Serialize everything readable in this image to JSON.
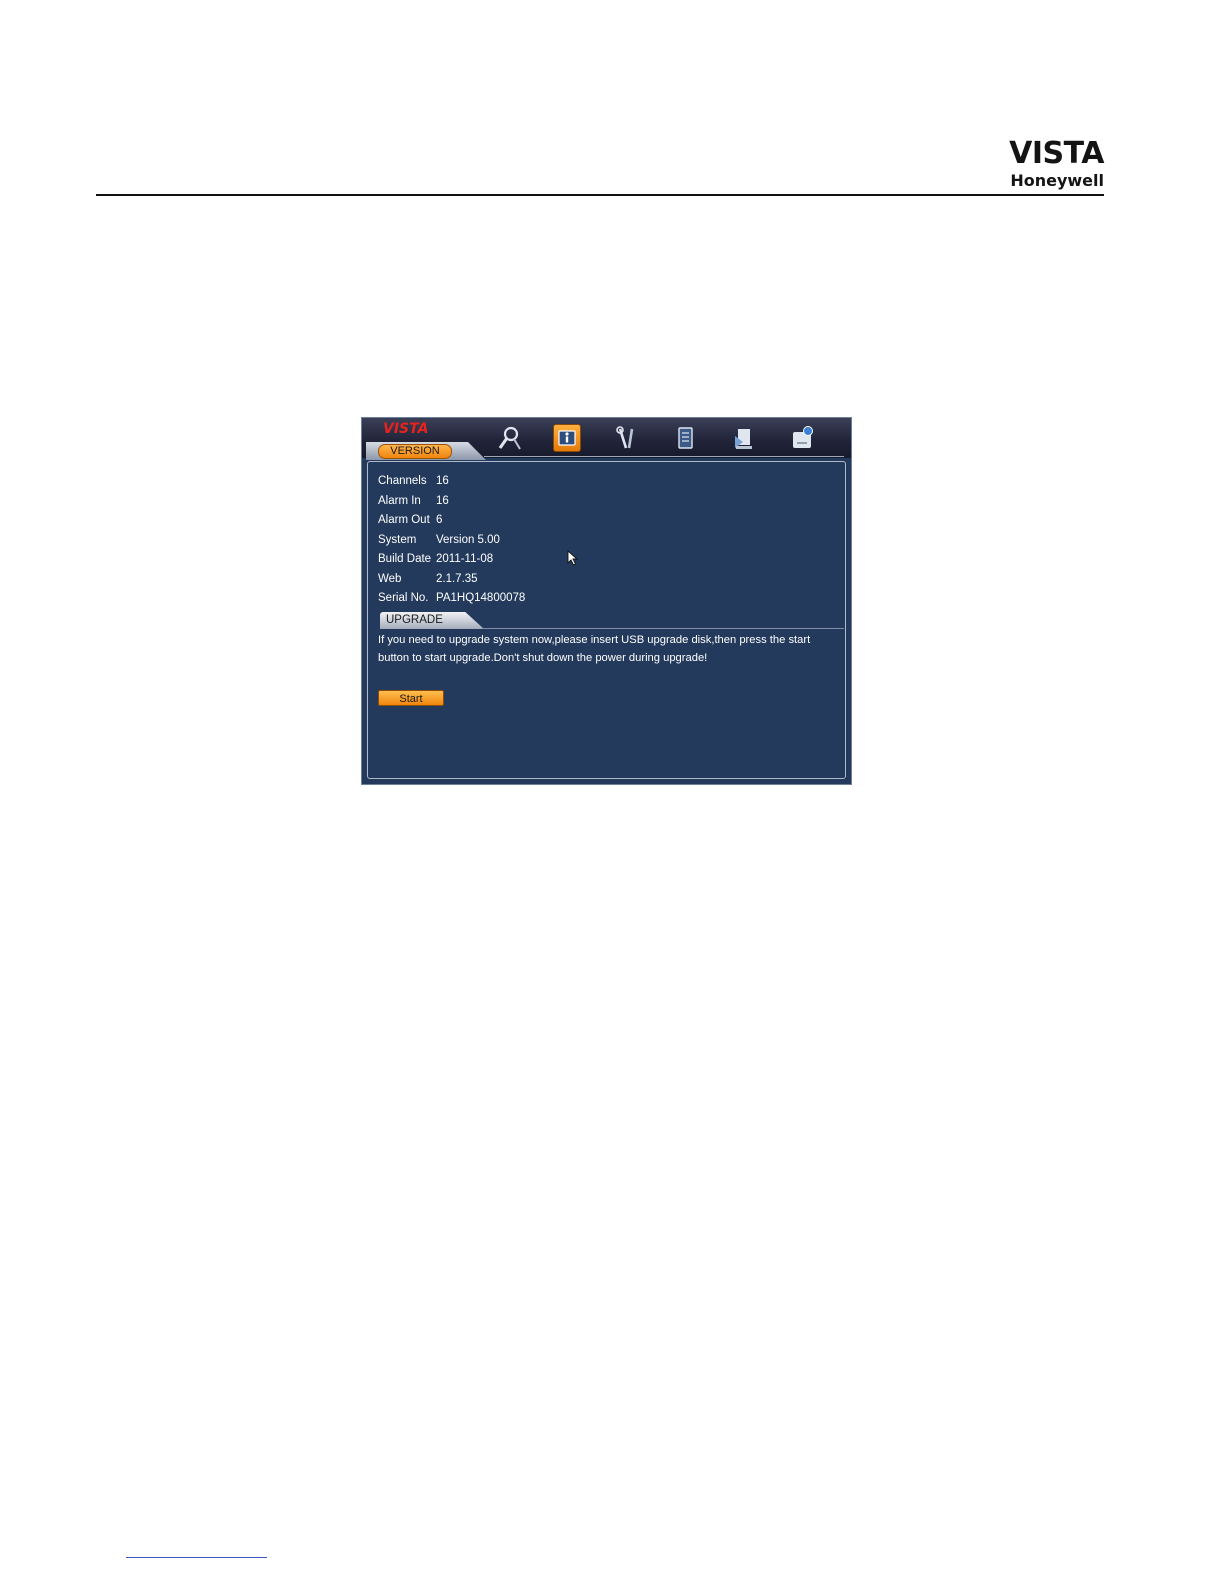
{
  "header": {
    "logo_line1": "VISTA",
    "logo_line2": "Honeywell"
  },
  "dvr": {
    "logo": "VISTA",
    "tab_version": "VERSION",
    "toolbar_icons": [
      "search-icon",
      "info-icon",
      "tools-icon",
      "backup-icon",
      "shutdown-icon",
      "disk-icon"
    ],
    "active_icon": "info-icon",
    "info": [
      {
        "label": "Channels",
        "value": "16"
      },
      {
        "label": "Alarm In",
        "value": "16"
      },
      {
        "label": "Alarm Out",
        "value": "6"
      },
      {
        "label": "System",
        "value": "Version 5.00"
      },
      {
        "label": "Build Date",
        "value": "2011-11-08"
      },
      {
        "label": "Web",
        "value": "2.1.7.35"
      },
      {
        "label": "Serial No.",
        "value": "PA1HQ14800078"
      }
    ],
    "tab_upgrade": "UPGRADE",
    "upgrade_message": "If you need to upgrade system now,please insert USB upgrade disk,then press the start button to start upgrade.Don't shut down the power during upgrade!",
    "start_label": "Start"
  },
  "colors": {
    "panel_bg": "#233a5c",
    "accent_orange": "#f0860e",
    "logo_red": "#e8221c"
  }
}
